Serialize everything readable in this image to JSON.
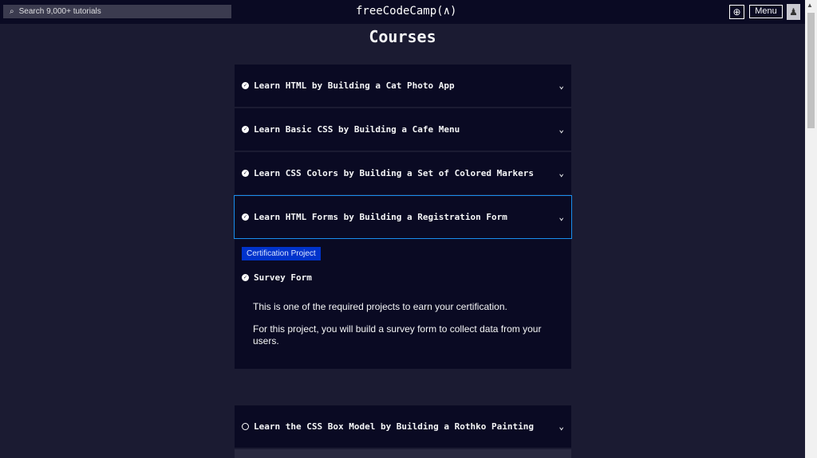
{
  "nav": {
    "search_placeholder": "Search 9,000+ tutorials",
    "logo": "freeCodeCamp(🔥)",
    "logo_text": "freeCodeCamp(∧)",
    "menu": "Menu"
  },
  "page_title": "Courses",
  "courses": [
    {
      "title": "Learn HTML by Building a Cat Photo App",
      "completed": true
    },
    {
      "title": "Learn Basic CSS by Building a Cafe Menu",
      "completed": true
    },
    {
      "title": "Learn CSS Colors by Building a Set of Colored Markers",
      "completed": true
    },
    {
      "title": "Learn HTML Forms by Building a Registration Form",
      "completed": true,
      "expanded": true
    },
    {
      "title": "Learn the CSS Box Model by Building a Rothko Painting",
      "completed": false
    }
  ],
  "project": {
    "badge": "Certification Project",
    "title": "Survey Form",
    "desc1": "This is one of the required projects to earn your certification.",
    "desc2": "For this project, you will build a survey form to collect data from your users."
  }
}
